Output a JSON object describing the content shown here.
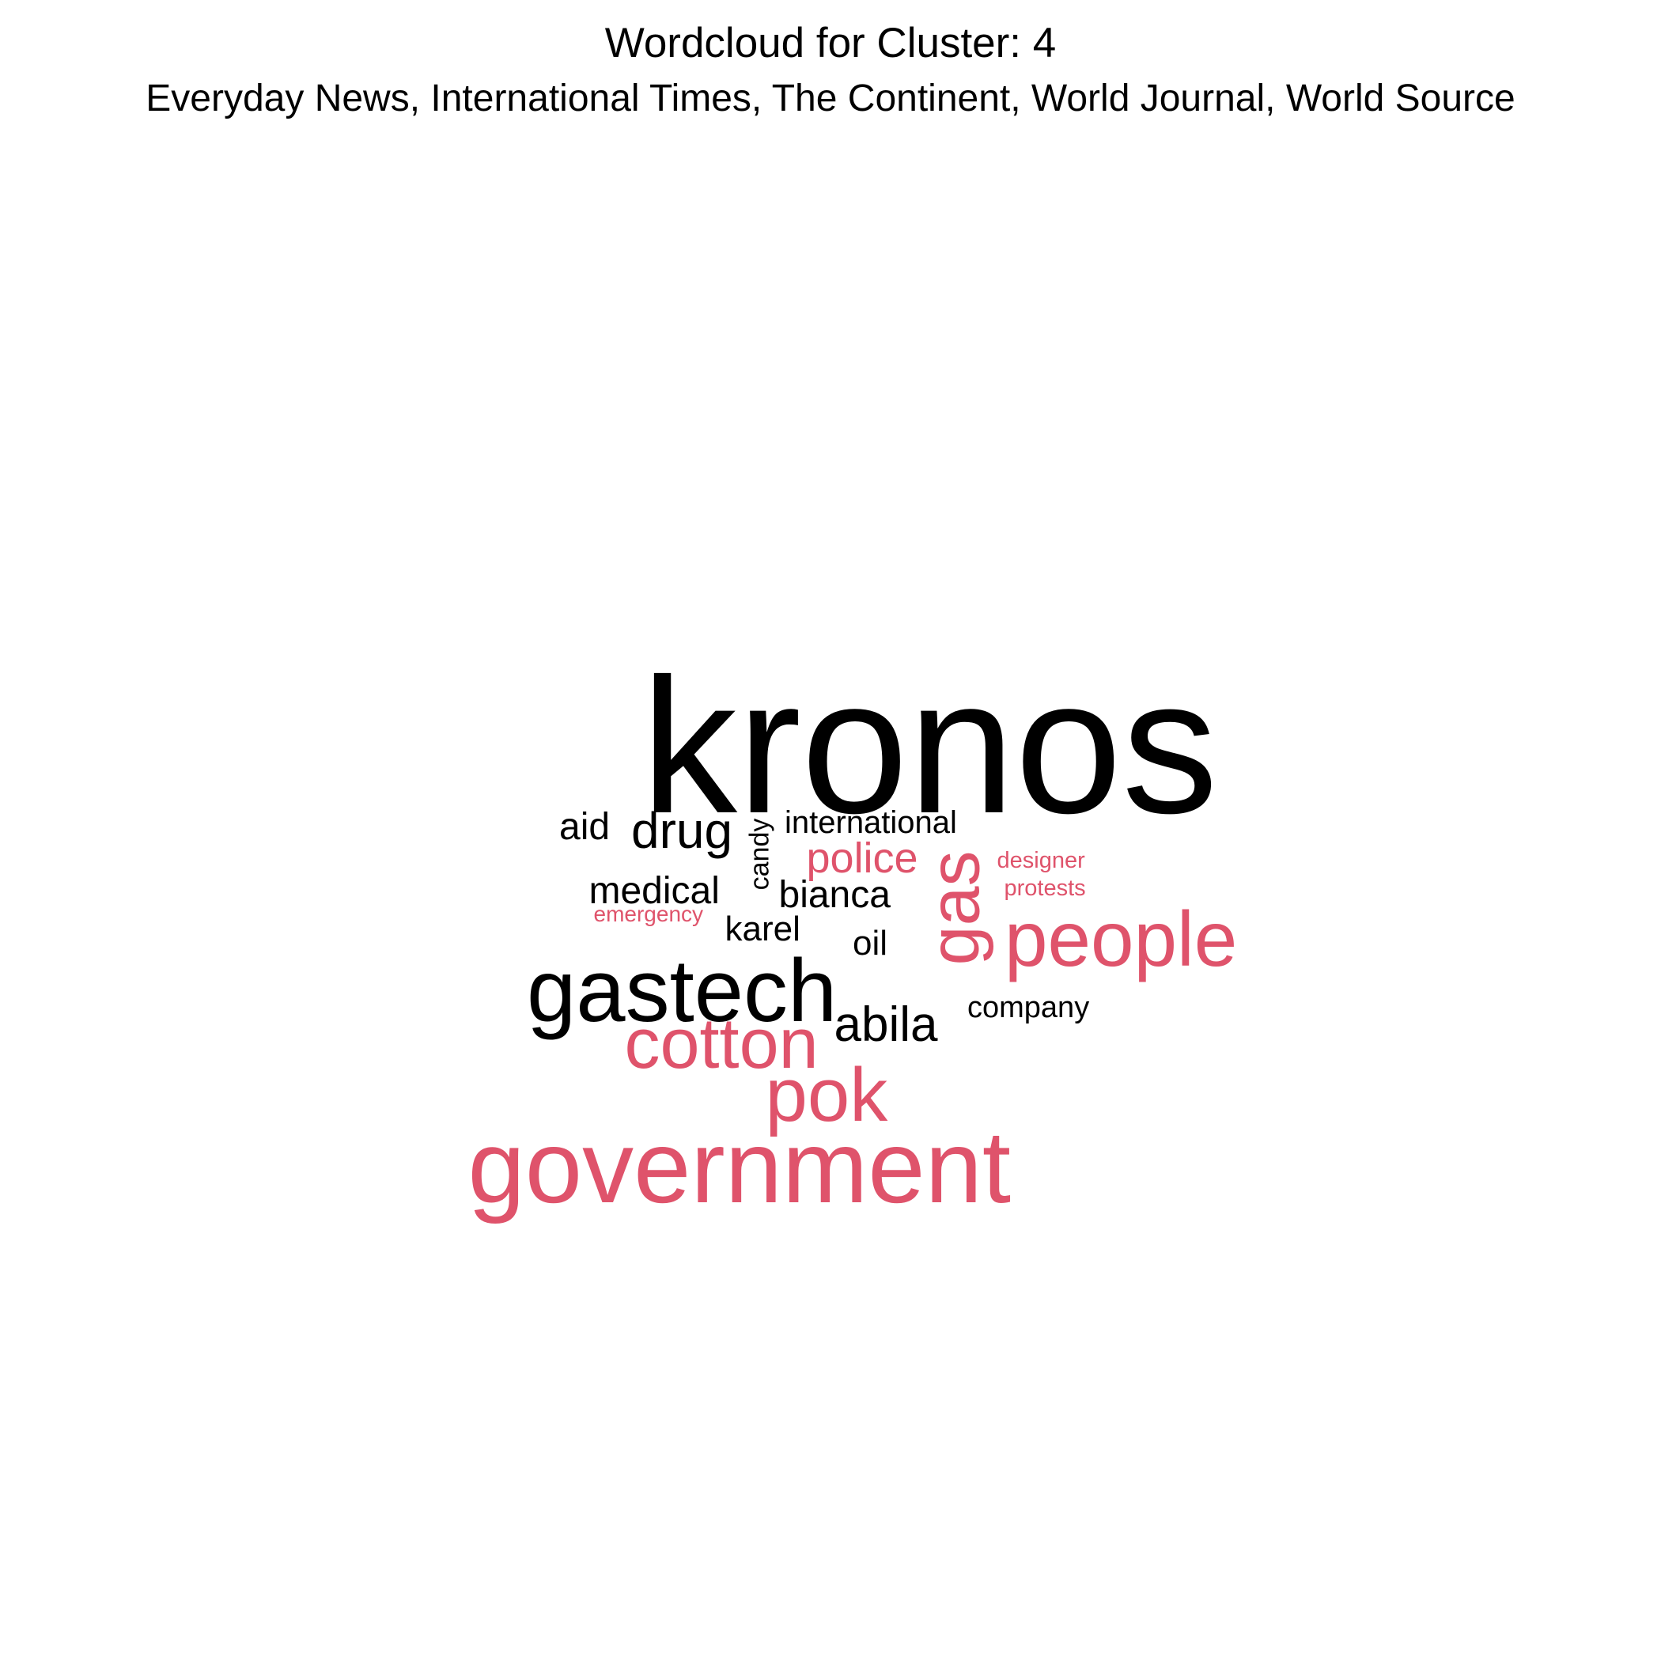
{
  "title": "Wordcloud for Cluster:  4",
  "subtitle": "Everyday News, International Times, The Continent, World Journal, World Source",
  "colors": {
    "dark": "#000000",
    "accent": "#df536b"
  },
  "words": [
    {
      "text": "kronos",
      "color": "dark"
    },
    {
      "text": "government",
      "color": "accent"
    },
    {
      "text": "gastech",
      "color": "dark"
    },
    {
      "text": "people",
      "color": "accent"
    },
    {
      "text": "pok",
      "color": "accent"
    },
    {
      "text": "cotton",
      "color": "accent"
    },
    {
      "text": "gas",
      "color": "accent"
    },
    {
      "text": "drug",
      "color": "dark"
    },
    {
      "text": "abila",
      "color": "dark"
    },
    {
      "text": "police",
      "color": "accent"
    },
    {
      "text": "medical",
      "color": "dark"
    },
    {
      "text": "bianca",
      "color": "dark"
    },
    {
      "text": "aid",
      "color": "dark"
    },
    {
      "text": "karel",
      "color": "dark"
    },
    {
      "text": "oil",
      "color": "dark"
    },
    {
      "text": "international",
      "color": "dark"
    },
    {
      "text": "company",
      "color": "dark"
    },
    {
      "text": "candy",
      "color": "dark"
    },
    {
      "text": "protests",
      "color": "accent"
    },
    {
      "text": "designer",
      "color": "accent"
    },
    {
      "text": "emergency",
      "color": "accent"
    }
  ]
}
